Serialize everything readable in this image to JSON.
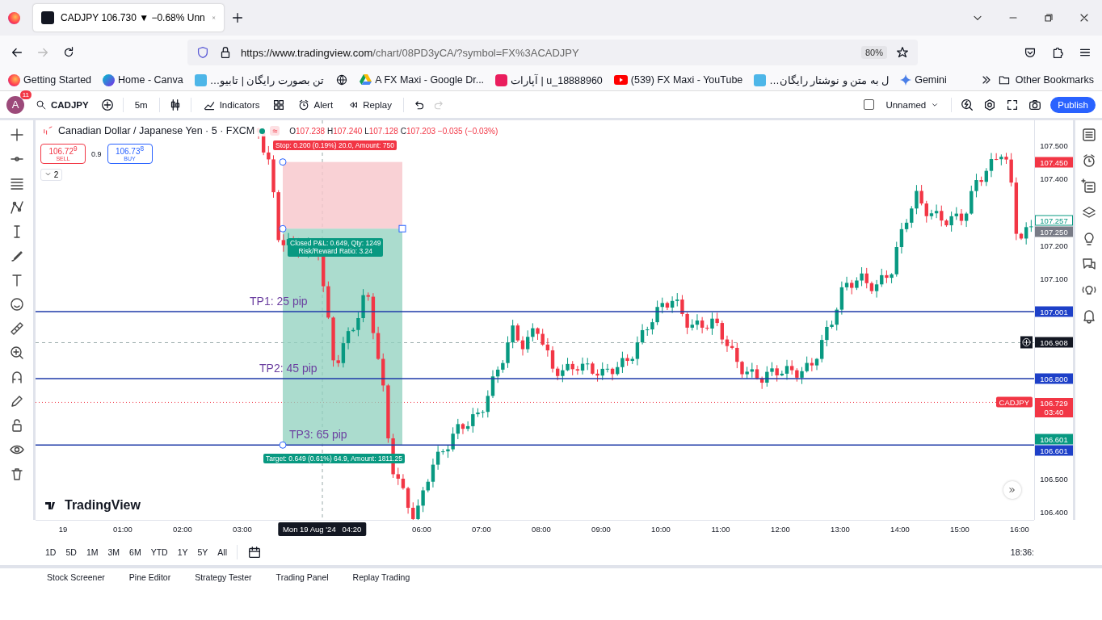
{
  "browser": {
    "tab_title": "CADJPY 106.730 ▼ −0.68% Unn",
    "url_host": "https://www.tradingview.com",
    "url_path": "/chart/08PD3yCA/?symbol=FX%3ACADJPY",
    "zoom": "80%",
    "bookmarks": [
      {
        "label": "Getting Started",
        "kind": "firefox"
      },
      {
        "label": "Home - Canva",
        "kind": "canva"
      },
      {
        "label": "…تن بصورت رایگان | تابیو",
        "kind": "tile"
      },
      {
        "kind": "globe"
      },
      {
        "label": "A FX Maxi - Google Dr...",
        "kind": "drive"
      },
      {
        "label": "آپارات | u_18888960",
        "kind": "aparat"
      },
      {
        "label": "(539) FX Maxi - YouTube",
        "kind": "youtube"
      },
      {
        "label": "…ل به متن و نوشتار رایگان",
        "kind": "tile"
      },
      {
        "label": "Gemini",
        "kind": "gemini"
      }
    ],
    "other_bookmarks": "Other Bookmarks"
  },
  "toolbar": {
    "avatar": "A",
    "notifications": "11",
    "symbol": "CADJPY",
    "interval": "5m",
    "indicators": "Indicators",
    "alert": "Alert",
    "replay": "Replay",
    "layout": "Unnamed",
    "layout_checked": false,
    "publish": "Publish"
  },
  "legend": {
    "title": "Canadian Dollar / Japanese Yen · 5 · FXCM",
    "badge": "≈",
    "ohlc": [
      {
        "key": "O",
        "value": "107.238"
      },
      {
        "key": "H",
        "value": "107.240"
      },
      {
        "key": "L",
        "value": "107.128"
      },
      {
        "key": "C",
        "value": "107.203"
      }
    ],
    "change": "−0.035 (−0.03%)",
    "sell_price": "106.72$^{9}$",
    "sell": "SELL",
    "spread": "0.9",
    "buy_price": "106.73$^{8}$",
    "buy": "BUY",
    "collapse": "2"
  },
  "position": {
    "stop_label": "Stop: 0.200 (0.19%) 20.0, Amount: 750",
    "pnl_label": "Closed P&L: 0.649, Qty: 1249",
    "ratio_label": "Risk/Reward Ratio: 3.24",
    "target_label": "Target: 0.649 (0.61%) 64.9, Amount: 1811.25"
  },
  "levels": [
    {
      "label": "TP1: 25 pip",
      "price": "107.001"
    },
    {
      "label": "TP2: 45 pip",
      "price": "106.800"
    },
    {
      "label": "TP3: 65 pip",
      "price": "106.601"
    }
  ],
  "price_axis": [
    {
      "text": "107.500",
      "kind": "tick"
    },
    {
      "text": "107.450",
      "kind": "tag",
      "color": "#f23645"
    },
    {
      "text": "107.400",
      "kind": "tick"
    },
    {
      "text": "107.257",
      "kind": "outline",
      "color": "#089981"
    },
    {
      "text": "107.250",
      "kind": "tag",
      "color": "#787b86"
    },
    {
      "text": "107.200",
      "kind": "tick"
    },
    {
      "text": "107.100",
      "kind": "tick"
    },
    {
      "text": "106.908",
      "kind": "crosshair",
      "color": "#131722"
    },
    {
      "text": "106.729",
      "kind": "last",
      "color": "#f23645",
      "symbol": "CADJPY",
      "countdown": "03:40"
    },
    {
      "text": "106.601",
      "kind": "tag",
      "color": "#089981"
    },
    {
      "text": "106.500",
      "kind": "tick"
    },
    {
      "text": "106.400",
      "kind": "tick"
    }
  ],
  "time_axis": [
    "19",
    "01:00",
    "02:00",
    "03:00",
    "06:00",
    "07:00",
    "08:00",
    "09:00",
    "10:00",
    "11:00",
    "12:00",
    "13:00",
    "14:00",
    "15:00",
    "16:00"
  ],
  "crosshair_time": "Mon 19 Aug '24   04:20",
  "brand": "TradingView",
  "ranges": [
    "1D",
    "5D",
    "1M",
    "3M",
    "6M",
    "YTD",
    "1Y",
    "5Y",
    "All"
  ],
  "clock": "18:36:",
  "bottom_tabs": [
    "Stock Screener",
    "Pine Editor",
    "Strategy Tester",
    "Trading Panel",
    "Replay Trading"
  ]
}
